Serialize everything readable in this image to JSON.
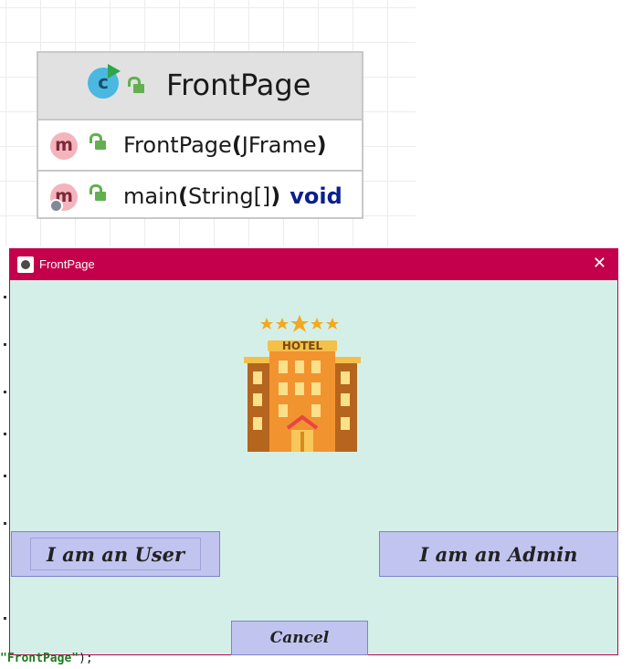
{
  "uml": {
    "class_name": "FrontPage",
    "class_icon_letter": "c",
    "methods": [
      {
        "icon_letter": "m",
        "name": "FrontPage",
        "params": "JFrame",
        "return_type": ""
      },
      {
        "icon_letter": "m",
        "name": "main",
        "params": "String[]",
        "return_type": "void"
      }
    ]
  },
  "window": {
    "title": "FrontPage",
    "close_glyph": "✕",
    "logo_text": "HOTEL",
    "buttons": {
      "user": "I am an User",
      "admin": "I am an Admin",
      "cancel": "Cancel"
    }
  },
  "code": {
    "string_literal": "FrontPage",
    "tail": ");",
    "quote": "\""
  },
  "colors": {
    "titlebar": "#c4004c",
    "window_bg": "#d4efe8",
    "button_bg": "#c1c4ef"
  }
}
